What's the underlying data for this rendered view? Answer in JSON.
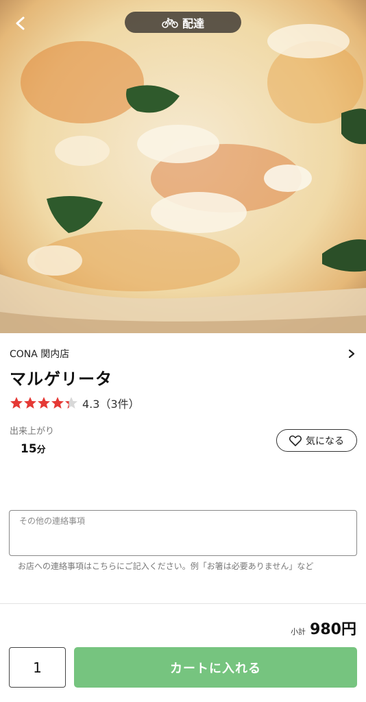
{
  "header": {
    "back_icon": "chevron-left-icon",
    "delivery_icon": "bicycle-icon",
    "delivery_label": "配達"
  },
  "product": {
    "store_name": "CONA 関内店",
    "title": "マルゲリータ",
    "rating_value": 4.3,
    "rating_text": "4.3（3件）",
    "star_color": "#e53935",
    "ready_label": "出来上がり",
    "ready_minutes": "15",
    "ready_unit": "分",
    "like_label": "気になる"
  },
  "note": {
    "placeholder": "その他の連絡事項",
    "help_text": "お店への連絡事項はこちらにご記入ください。例「お箸は必要ありません」など"
  },
  "footer": {
    "subtotal_label": "小計",
    "subtotal_value": "980円",
    "quantity": "1",
    "add_to_cart_label": "カートに入れる",
    "accent_color": "#76c47f"
  }
}
